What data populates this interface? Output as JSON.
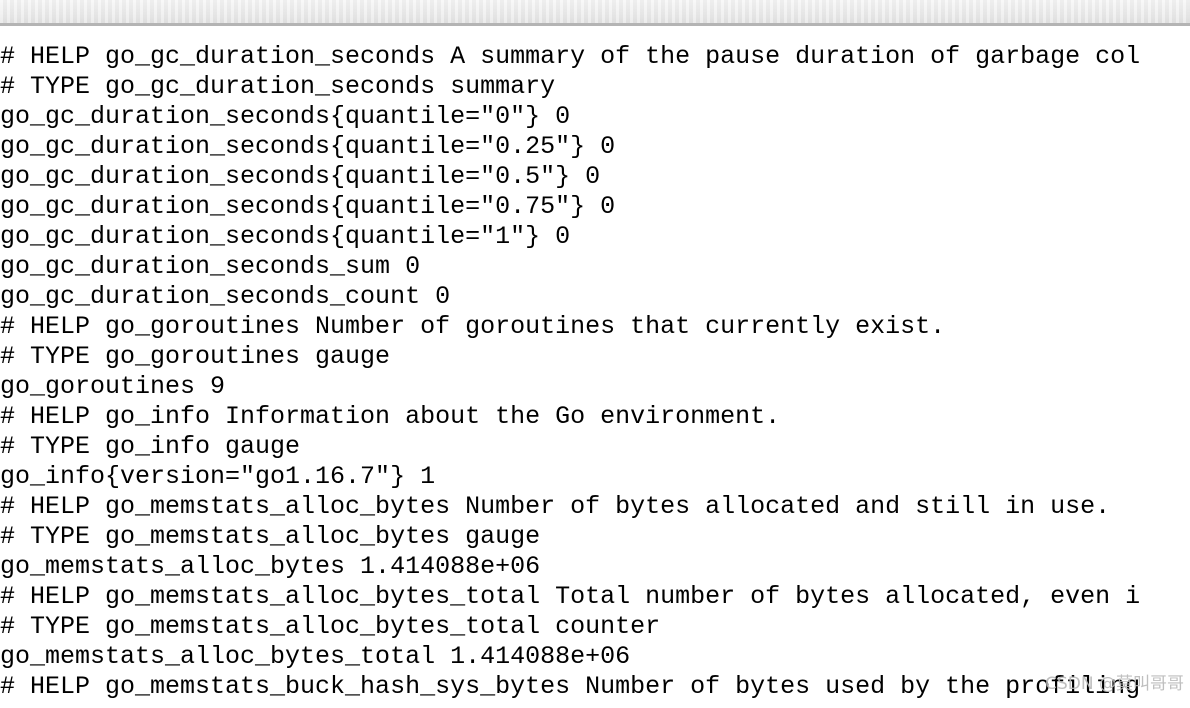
{
  "browser": {
    "chrome_strip_color": "#e8e8e8",
    "chrome_border_color": "#b4b4b4"
  },
  "watermark": {
    "text": "CSDN @莫叫哥哥",
    "color": "#b9b9b9"
  },
  "metrics": {
    "font_size_px": 25,
    "line_height_px": 30,
    "text_color": "#000000",
    "background_color": "#ffffff",
    "lines": [
      "# HELP go_gc_duration_seconds A summary of the pause duration of garbage col",
      "# TYPE go_gc_duration_seconds summary",
      "go_gc_duration_seconds{quantile=\"0\"} 0",
      "go_gc_duration_seconds{quantile=\"0.25\"} 0",
      "go_gc_duration_seconds{quantile=\"0.5\"} 0",
      "go_gc_duration_seconds{quantile=\"0.75\"} 0",
      "go_gc_duration_seconds{quantile=\"1\"} 0",
      "go_gc_duration_seconds_sum 0",
      "go_gc_duration_seconds_count 0",
      "# HELP go_goroutines Number of goroutines that currently exist.",
      "# TYPE go_goroutines gauge",
      "go_goroutines 9",
      "# HELP go_info Information about the Go environment.",
      "# TYPE go_info gauge",
      "go_info{version=\"go1.16.7\"} 1",
      "# HELP go_memstats_alloc_bytes Number of bytes allocated and still in use.",
      "# TYPE go_memstats_alloc_bytes gauge",
      "go_memstats_alloc_bytes 1.414088e+06",
      "# HELP go_memstats_alloc_bytes_total Total number of bytes allocated, even i",
      "# TYPE go_memstats_alloc_bytes_total counter",
      "go_memstats_alloc_bytes_total 1.414088e+06",
      "# HELP go_memstats_buck_hash_sys_bytes Number of bytes used by the profiling"
    ]
  }
}
